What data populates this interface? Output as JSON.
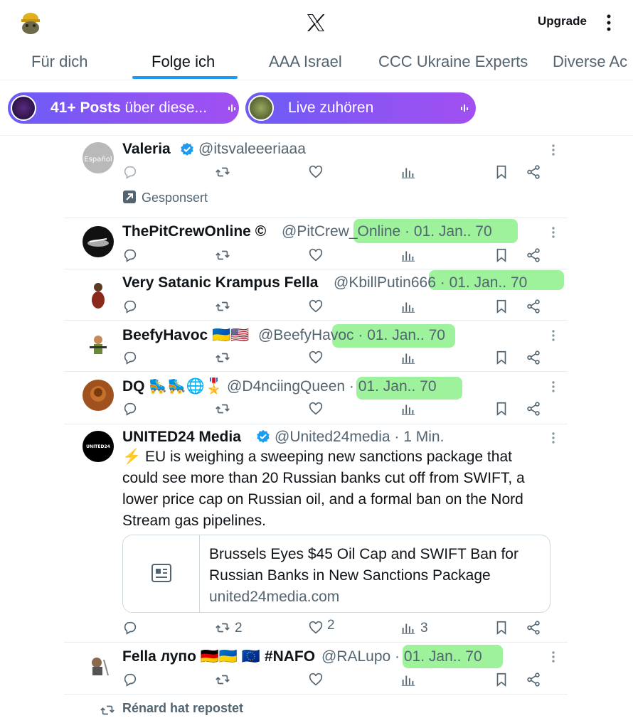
{
  "header": {
    "upgrade_label": "Upgrade"
  },
  "tabs": [
    "Für dich",
    "Folge ich",
    "AAA Israel",
    "CCC Ukraine Experts",
    "Diverse Ac"
  ],
  "pills": [
    {
      "bold": "41+ Posts",
      "rest": " über diese..."
    },
    {
      "bold": "",
      "rest": "Live zuhören"
    }
  ],
  "tweets": [
    {
      "name": "Valeria",
      "handle": "@itsvaleeeriaaa",
      "sponsored": "Gesponsert"
    },
    {
      "name": "ThePitCrewOnline ©",
      "handle": "@PitCrew_Online · 01. Jan.. 70"
    },
    {
      "name": "Very Satanic Krampus Fella",
      "handle": "@KbillPutin666 · 01. Jan.. 70"
    },
    {
      "name": "BeefyHavoc 🇺🇦🇺🇸",
      "handle": "@BeefyHavoc · 01. Jan.. 70"
    },
    {
      "name": "DQ 🛼🛼🌐🎖️",
      "handle": "@D4nciingQueen · 01. Jan.. 70"
    },
    {
      "name": "UNITED24 Media",
      "handle": "@United24media · 1 Min.",
      "text": "⚡️ EU is weighing a sweeping new sanctions package that could see more than 20 Russian banks cut off from SWIFT, a lower price cap on Russian oil, and a formal ban on the Nord Stream gas pipelines.",
      "card_title": "Brussels Eyes $45 Oil Cap and SWIFT Ban for Russian Banks in New Sanctions Package",
      "card_domain": "united24media.com",
      "retweets": "2",
      "likes": "2",
      "views": "3"
    },
    {
      "name": "Fella лупо 🇩🇪🇺🇦 🇪🇺 #NAFO",
      "handle": "@RALupo · 01. Jan.. 70"
    }
  ],
  "reposted_by": "Rénard hat repostet",
  "icons": [
    "x-logo-icon",
    "more-icon",
    "reply-icon",
    "retweet-icon",
    "like-icon",
    "views-icon",
    "bookmark-icon",
    "share-icon",
    "verified-icon",
    "sponsored-arrow-icon",
    "article-icon",
    "audio-bars-icon"
  ]
}
